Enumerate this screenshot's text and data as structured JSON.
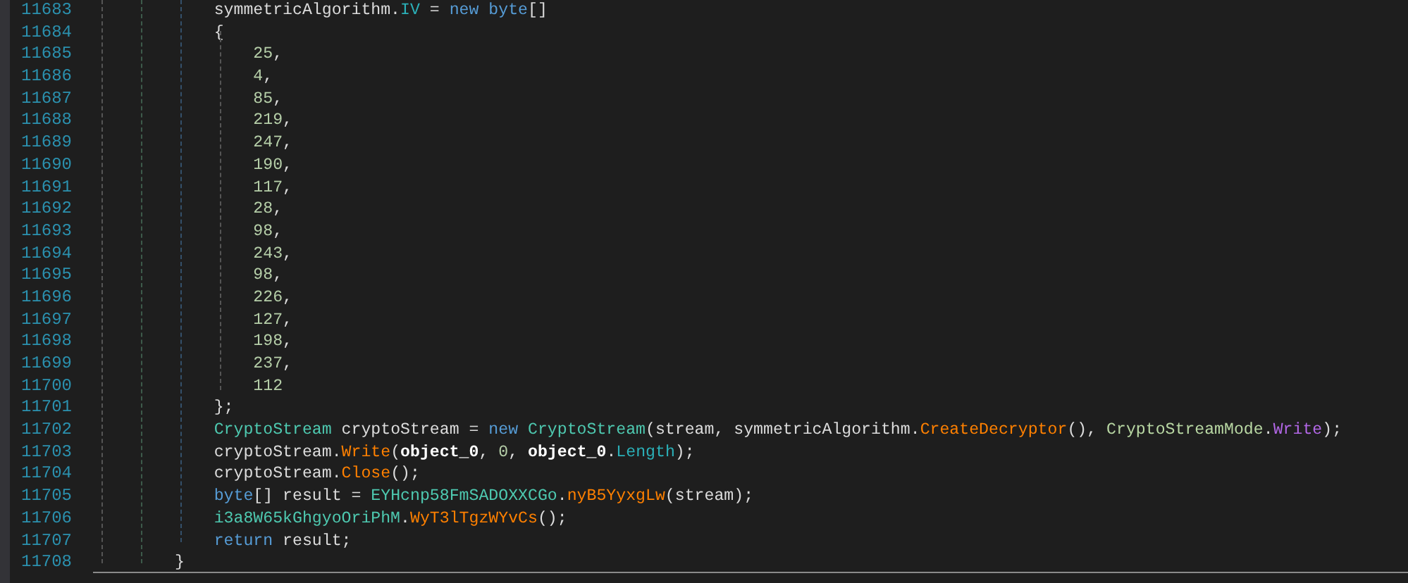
{
  "lines": [
    {
      "number": "11683",
      "tokens": [
        {
          "kind": "plain",
          "text": "    symmetricAlgorithm."
        },
        {
          "kind": "property",
          "text": "IV"
        },
        {
          "kind": "plain",
          "text": " = "
        },
        {
          "kind": "keyword",
          "text": "new byte"
        },
        {
          "kind": "plain",
          "text": "[]"
        }
      ]
    },
    {
      "number": "11684",
      "tokens": [
        {
          "kind": "plain",
          "text": "    {"
        }
      ]
    },
    {
      "number": "11685",
      "tokens": [
        {
          "kind": "number",
          "text": "        25"
        },
        {
          "kind": "plain",
          "text": ","
        }
      ]
    },
    {
      "number": "11686",
      "tokens": [
        {
          "kind": "number",
          "text": "        4"
        },
        {
          "kind": "plain",
          "text": ","
        }
      ]
    },
    {
      "number": "11687",
      "tokens": [
        {
          "kind": "number",
          "text": "        85"
        },
        {
          "kind": "plain",
          "text": ","
        }
      ]
    },
    {
      "number": "11688",
      "tokens": [
        {
          "kind": "number",
          "text": "        219"
        },
        {
          "kind": "plain",
          "text": ","
        }
      ]
    },
    {
      "number": "11689",
      "tokens": [
        {
          "kind": "number",
          "text": "        247"
        },
        {
          "kind": "plain",
          "text": ","
        }
      ]
    },
    {
      "number": "11690",
      "tokens": [
        {
          "kind": "number",
          "text": "        190"
        },
        {
          "kind": "plain",
          "text": ","
        }
      ]
    },
    {
      "number": "11691",
      "tokens": [
        {
          "kind": "number",
          "text": "        117"
        },
        {
          "kind": "plain",
          "text": ","
        }
      ]
    },
    {
      "number": "11692",
      "tokens": [
        {
          "kind": "number",
          "text": "        28"
        },
        {
          "kind": "plain",
          "text": ","
        }
      ]
    },
    {
      "number": "11693",
      "tokens": [
        {
          "kind": "number",
          "text": "        98"
        },
        {
          "kind": "plain",
          "text": ","
        }
      ]
    },
    {
      "number": "11694",
      "tokens": [
        {
          "kind": "number",
          "text": "        243"
        },
        {
          "kind": "plain",
          "text": ","
        }
      ]
    },
    {
      "number": "11695",
      "tokens": [
        {
          "kind": "number",
          "text": "        98"
        },
        {
          "kind": "plain",
          "text": ","
        }
      ]
    },
    {
      "number": "11696",
      "tokens": [
        {
          "kind": "number",
          "text": "        226"
        },
        {
          "kind": "plain",
          "text": ","
        }
      ]
    },
    {
      "number": "11697",
      "tokens": [
        {
          "kind": "number",
          "text": "        127"
        },
        {
          "kind": "plain",
          "text": ","
        }
      ]
    },
    {
      "number": "11698",
      "tokens": [
        {
          "kind": "number",
          "text": "        198"
        },
        {
          "kind": "plain",
          "text": ","
        }
      ]
    },
    {
      "number": "11699",
      "tokens": [
        {
          "kind": "number",
          "text": "        237"
        },
        {
          "kind": "plain",
          "text": ","
        }
      ]
    },
    {
      "number": "11700",
      "tokens": [
        {
          "kind": "number",
          "text": "        112"
        }
      ]
    },
    {
      "number": "11701",
      "tokens": [
        {
          "kind": "plain",
          "text": "    };"
        }
      ]
    },
    {
      "number": "11702",
      "tokens": [
        {
          "kind": "type",
          "text": "    CryptoStream"
        },
        {
          "kind": "plain",
          "text": " cryptoStream = "
        },
        {
          "kind": "keyword",
          "text": "new "
        },
        {
          "kind": "type",
          "text": "CryptoStream"
        },
        {
          "kind": "plain",
          "text": "(stream, symmetricAlgorithm."
        },
        {
          "kind": "method",
          "text": "CreateDecryptor"
        },
        {
          "kind": "plain",
          "text": "(), "
        },
        {
          "kind": "enum",
          "text": "CryptoStreamMode"
        },
        {
          "kind": "plain",
          "text": "."
        },
        {
          "kind": "member",
          "text": "Write"
        },
        {
          "kind": "plain",
          "text": ");"
        }
      ]
    },
    {
      "number": "11703",
      "tokens": [
        {
          "kind": "plain",
          "text": "    cryptoStream."
        },
        {
          "kind": "method",
          "text": "Write"
        },
        {
          "kind": "plain",
          "text": "("
        },
        {
          "kind": "param",
          "text": "object_0"
        },
        {
          "kind": "plain",
          "text": ", "
        },
        {
          "kind": "number",
          "text": "0"
        },
        {
          "kind": "plain",
          "text": ", "
        },
        {
          "kind": "param",
          "text": "object_0"
        },
        {
          "kind": "plain",
          "text": "."
        },
        {
          "kind": "property",
          "text": "Length"
        },
        {
          "kind": "plain",
          "text": ");"
        }
      ]
    },
    {
      "number": "11704",
      "tokens": [
        {
          "kind": "plain",
          "text": "    cryptoStream."
        },
        {
          "kind": "method",
          "text": "Close"
        },
        {
          "kind": "plain",
          "text": "();"
        }
      ]
    },
    {
      "number": "11705",
      "tokens": [
        {
          "kind": "keyword",
          "text": "    byte"
        },
        {
          "kind": "plain",
          "text": "[] result = "
        },
        {
          "kind": "type",
          "text": "EYHcnp58FmSADOXXCGo"
        },
        {
          "kind": "plain",
          "text": "."
        },
        {
          "kind": "method",
          "text": "nyB5YyxgLw"
        },
        {
          "kind": "plain",
          "text": "(stream);"
        }
      ]
    },
    {
      "number": "11706",
      "tokens": [
        {
          "kind": "type",
          "text": "    i3a8W65kGhgyoOriPhM"
        },
        {
          "kind": "plain",
          "text": "."
        },
        {
          "kind": "method",
          "text": "WyT3lTgzWYvCs"
        },
        {
          "kind": "plain",
          "text": "();"
        }
      ]
    },
    {
      "number": "11707",
      "tokens": [
        {
          "kind": "keyword",
          "text": "    return"
        },
        {
          "kind": "plain",
          "text": " result;"
        }
      ]
    },
    {
      "number": "11708",
      "tokens": [
        {
          "kind": "plain",
          "text": "}"
        }
      ]
    }
  ]
}
